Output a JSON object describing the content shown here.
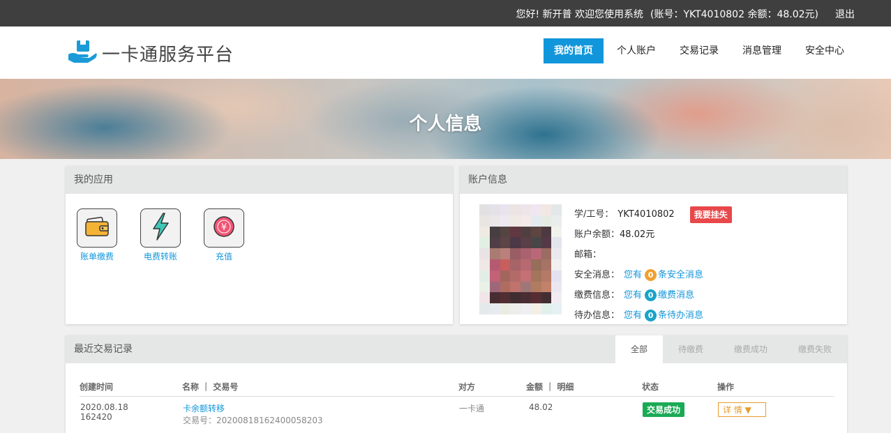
{
  "topbar": {
    "greeting": "您好! 新开普 欢迎您使用系统",
    "account_info": "(账号：YKT4010802 余额：48.02元)",
    "logout": "退出"
  },
  "logo": {
    "text": "一卡通服务平台",
    "icon": "hand-card-icon"
  },
  "nav": [
    "我的首页",
    "个人账户",
    "交易记录",
    "消息管理",
    "安全中心"
  ],
  "banner": {
    "title": "个人信息"
  },
  "apps": {
    "title": "我的应用",
    "items": [
      {
        "label": "账单缴费",
        "icon": "wallet-icon"
      },
      {
        "label": "电费转账",
        "icon": "lightning-icon"
      },
      {
        "label": "充值",
        "icon": "yuan-icon"
      }
    ]
  },
  "account": {
    "title": "账户信息",
    "student_id_label": "学/工号：",
    "student_id": "YKT4010802",
    "report_loss": "我要挂失",
    "balance_label": "账户余额：",
    "balance": "48.02元",
    "email_label": "邮箱：",
    "security_label": "安全消息：",
    "payment_label": "缴费信息：",
    "todo_label": "待办信息：",
    "you_have": "您有",
    "security_count": "0",
    "security_suffix": "条安全消息",
    "payment_count": "0",
    "payment_suffix": "缴费消息",
    "todo_count": "0",
    "todo_suffix": "条待办消息"
  },
  "transactions": {
    "title": "最近交易记录",
    "tabs": [
      "全部",
      "待缴费",
      "缴费成功",
      "缴费失败"
    ],
    "headers": [
      "创建时间",
      "名称 ｜ 交易号",
      "对方",
      "金额 ｜ 明细",
      "状态",
      "操作"
    ],
    "rows": [
      {
        "date": "2020.08.18",
        "time": "162420",
        "name": "卡余额转移",
        "trade_no": "交易号：20200818162400058203",
        "counterpart": "一卡通",
        "amount": "48.02",
        "status": "交易成功",
        "action": "详 情"
      }
    ]
  },
  "colors": {
    "accent": "#1296db",
    "topbar": "#3f3f3f",
    "danger": "#e8484a",
    "success": "#1aaa55",
    "orange": "#f0a030",
    "cyan": "#1aa3c8"
  }
}
